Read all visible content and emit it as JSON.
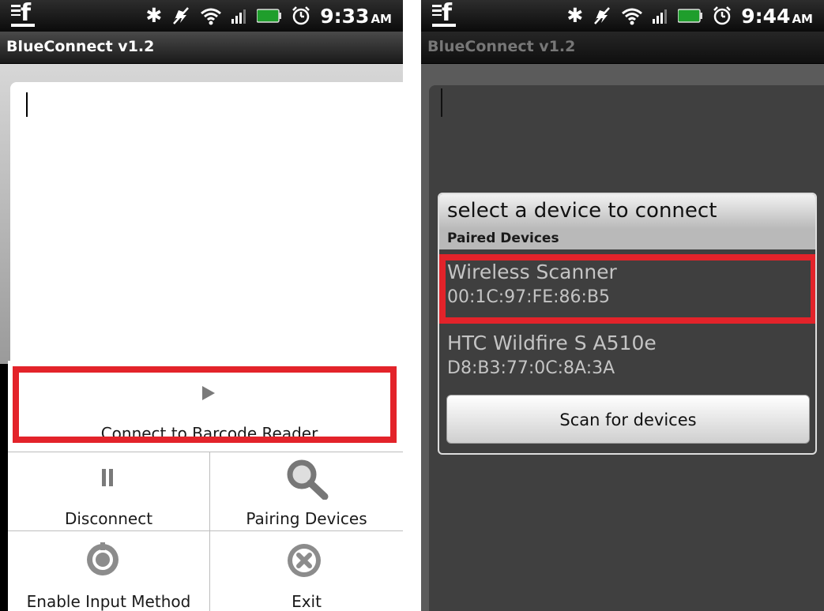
{
  "left": {
    "status": {
      "time": "9:33",
      "ampm": "AM"
    },
    "title": "BlueConnect v1.2",
    "menu": {
      "connect": "Connect to Barcode Reader",
      "disconnect": "Disconnect",
      "pairing": "Pairing Devices",
      "input_method": "Enable Input Method",
      "exit": "Exit"
    },
    "highlight_color": "#e3232a"
  },
  "right": {
    "status": {
      "time": "9:44",
      "ampm": "AM"
    },
    "title": "BlueConnect v1.2",
    "dialog": {
      "title": "select a device to connect",
      "section": "Paired Devices",
      "devices": [
        {
          "name": "Wireless Scanner",
          "address": "00:1C:97:FE:86:B5"
        },
        {
          "name": "HTC Wildfire S A510e",
          "address": "D8:B3:77:0C:8A:3A"
        }
      ],
      "scan_button": "Scan for devices"
    },
    "highlight_color": "#e3232a"
  },
  "icons": [
    "facebook-icon",
    "bluetooth-icon",
    "no-sync-icon",
    "wifi-icon",
    "signal-icon",
    "battery-icon",
    "alarm-icon",
    "play-icon",
    "pause-icon",
    "search-icon",
    "settings-icon",
    "exit-icon"
  ]
}
